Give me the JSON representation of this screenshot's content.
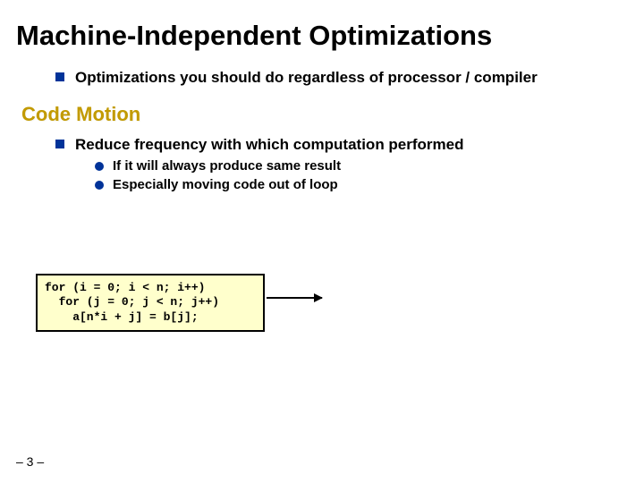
{
  "title": "Machine-Independent Optimizations",
  "intro": "Optimizations you should do regardless of processor / compiler",
  "subhead": "Code Motion",
  "point": "Reduce frequency with which computation performed",
  "sub1": "If it will always produce same result",
  "sub2": "Especially moving code out of loop",
  "code": "for (i = 0; i < n; i++)\n  for (j = 0; j < n; j++)\n    a[n*i + j] = b[j];",
  "page": "– 3 –"
}
